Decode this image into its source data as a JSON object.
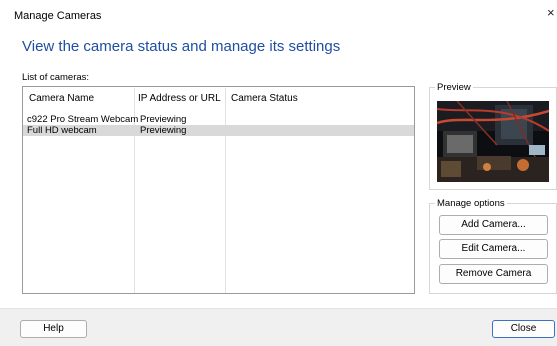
{
  "window": {
    "title": "Manage Cameras",
    "close_glyph": "×"
  },
  "heading": "View the camera status and manage its settings",
  "camera_list": {
    "label": "List of cameras:",
    "columns": [
      "Camera Name",
      "IP Address or URL",
      "Camera Status"
    ],
    "rows": [
      {
        "name": "c922 Pro Stream Webcam",
        "address": "Previewing",
        "status": "",
        "selected": false
      },
      {
        "name": "Full HD webcam",
        "address": "Previewing",
        "status": "",
        "selected": true
      }
    ]
  },
  "preview": {
    "legend": "Preview"
  },
  "manage_options": {
    "legend": "Manage options",
    "add_label": "Add Camera...",
    "edit_label": "Edit Camera...",
    "remove_label": "Remove Camera"
  },
  "footer": {
    "help_label": "Help",
    "close_label": "Close"
  },
  "colors": {
    "heading": "#1f4fa3",
    "selected_row": "#d9d9d9",
    "footer_bg": "#f0f0f0"
  }
}
